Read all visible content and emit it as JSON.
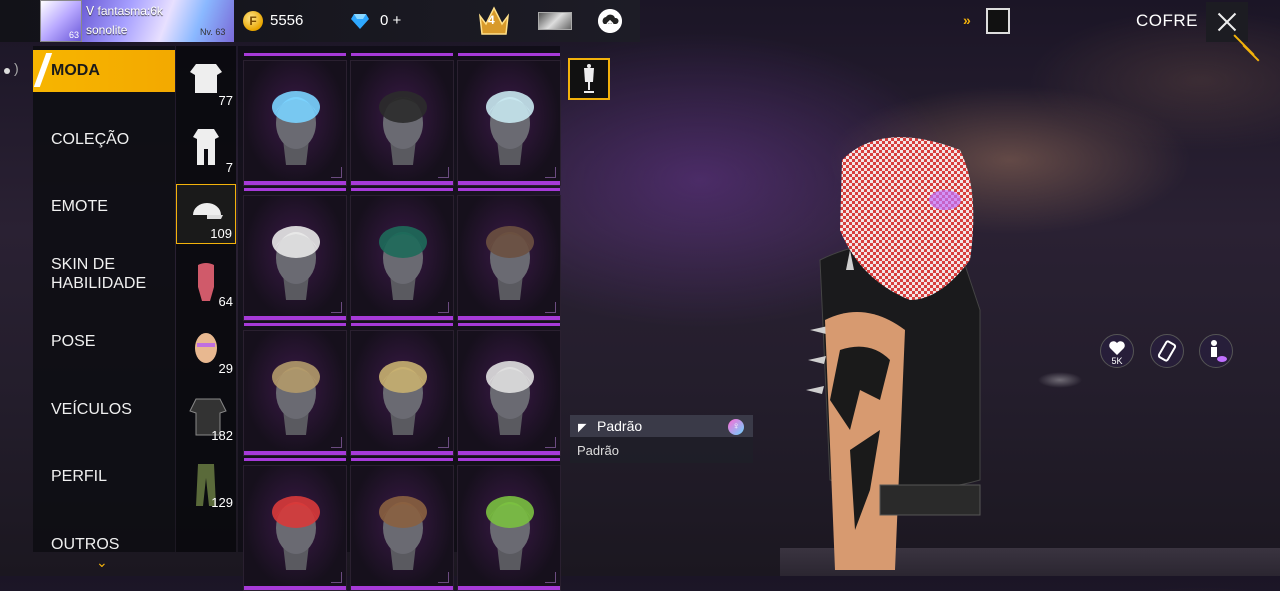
{
  "player": {
    "name": "fantasma:6k",
    "guild": "sonolite",
    "level_badge": "63",
    "level_label": "Nv. 63"
  },
  "currency": {
    "coins": "5556",
    "diamonds": "0 +"
  },
  "rank": {
    "value": "4"
  },
  "header": {
    "vault_label": "COFRE"
  },
  "nav": {
    "items": [
      {
        "label": "MODA",
        "active": true
      },
      {
        "label": "COLEÇÃO"
      },
      {
        "label": "EMOTE"
      },
      {
        "label": "SKIN DE HABILIDADE"
      },
      {
        "label": "POSE"
      },
      {
        "label": "VEÍCULOS"
      },
      {
        "label": "PERFIL"
      },
      {
        "label": "OUTROS"
      }
    ]
  },
  "subcategories": [
    {
      "icon": "full-outfit-icon",
      "count": "77"
    },
    {
      "icon": "jumpsuit-icon",
      "count": "7"
    },
    {
      "icon": "cap-icon",
      "count": "109",
      "active": true
    },
    {
      "icon": "mask-icon",
      "count": "64"
    },
    {
      "icon": "face-paint-icon",
      "count": "29"
    },
    {
      "icon": "top-icon",
      "count": "182"
    },
    {
      "icon": "pants-icon",
      "count": "129"
    }
  ],
  "grid": [
    {
      "icon": "bucket-hat-icon",
      "color": "#7ad3ff"
    },
    {
      "icon": "wide-hat-icon",
      "color": "#2b2b2b"
    },
    {
      "icon": "white-hair-icon",
      "color": "#c8e8f0"
    },
    {
      "icon": "spiky-hair-icon",
      "color": "#e8e8e8"
    },
    {
      "icon": "headband-icon",
      "color": "#1e6a5a"
    },
    {
      "icon": "brown-hair-icon",
      "color": "#6b5040"
    },
    {
      "icon": "hood-icon",
      "color": "#b39a6a"
    },
    {
      "icon": "tiger-mask-icon",
      "color": "#c8b070"
    },
    {
      "icon": "silver-hair-icon",
      "color": "#e0e0e0"
    },
    {
      "icon": "red-mohawk-icon",
      "color": "#d83a3a"
    },
    {
      "icon": "dreadlocks-icon",
      "color": "#8a6040"
    },
    {
      "icon": "frog-hat-icon",
      "color": "#7ac040"
    }
  ],
  "tooltip": {
    "title": "Padrão",
    "subtitle": "Padrão"
  },
  "right_controls": [
    {
      "icon": "heart-hand-icon",
      "label": "5K"
    },
    {
      "icon": "phone-rotate-icon",
      "label": ""
    },
    {
      "icon": "preview-eye-icon",
      "label": ""
    }
  ],
  "colors": {
    "accent": "#f3b20b",
    "rarity_purple": "#a63ad8",
    "panel": "#0e0e14"
  }
}
